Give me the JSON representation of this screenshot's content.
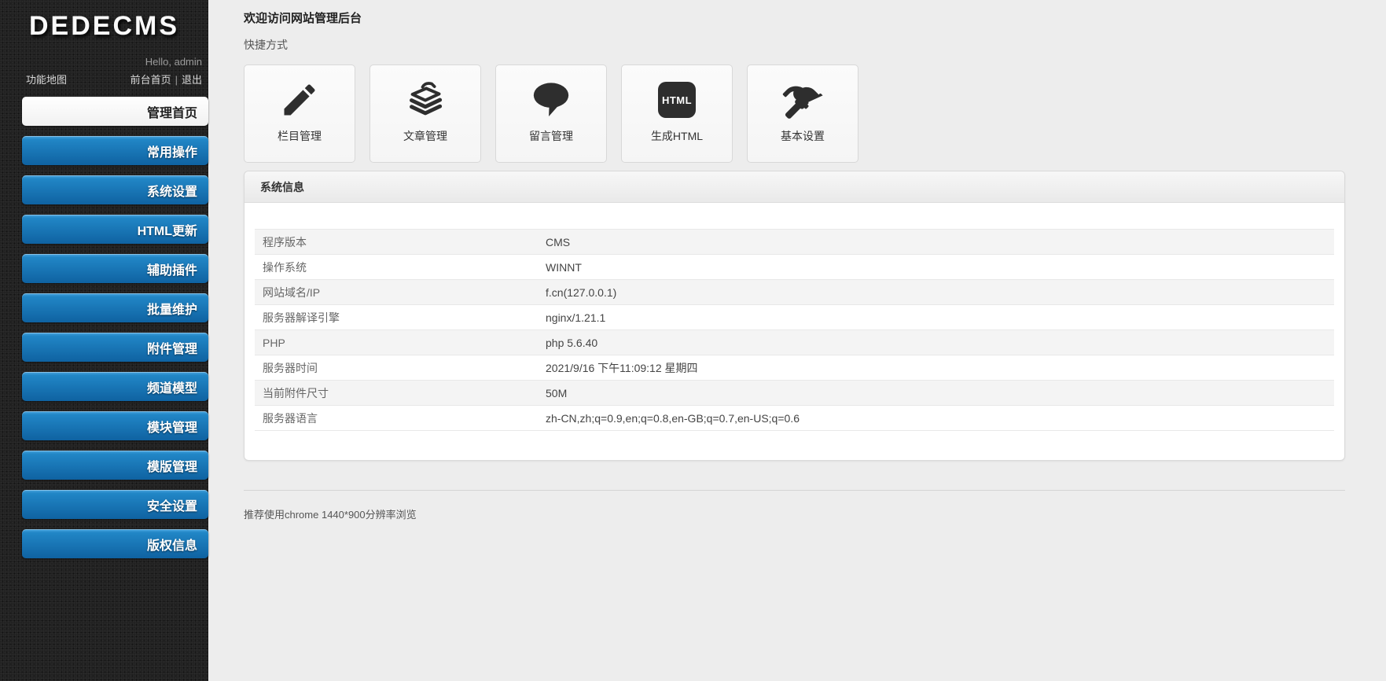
{
  "sidebar": {
    "logo": "DEDECMS",
    "greeting": "Hello, admin",
    "links": {
      "map": "功能地图",
      "front": "前台首页",
      "divider": "|",
      "logout": "退出"
    },
    "menu": [
      {
        "label": "管理首页",
        "active": true
      },
      {
        "label": "常用操作",
        "active": false
      },
      {
        "label": "系统设置",
        "active": false
      },
      {
        "label": "HTML更新",
        "active": false
      },
      {
        "label": "辅助插件",
        "active": false
      },
      {
        "label": "批量维护",
        "active": false
      },
      {
        "label": "附件管理",
        "active": false
      },
      {
        "label": "频道模型",
        "active": false
      },
      {
        "label": "模块管理",
        "active": false
      },
      {
        "label": "模版管理",
        "active": false
      },
      {
        "label": "安全设置",
        "active": false
      },
      {
        "label": "版权信息",
        "active": false
      }
    ]
  },
  "main": {
    "title": "欢迎访问网站管理后台",
    "shortcuts_label": "快捷方式",
    "shortcuts": [
      {
        "label": "栏目管理",
        "icon": "pencil-icon"
      },
      {
        "label": "文章管理",
        "icon": "stacked-papers-icon"
      },
      {
        "label": "留言管理",
        "icon": "speech-bubble-icon"
      },
      {
        "label": "生成HTML",
        "icon": "html-badge-icon",
        "badge_text": "HTML"
      },
      {
        "label": "基本设置",
        "icon": "hammer-icon"
      }
    ],
    "system_info": {
      "header": "系统信息",
      "rows": [
        {
          "label": "程序版本",
          "value": "CMS"
        },
        {
          "label": "操作系统",
          "value": "WINNT"
        },
        {
          "label": "网站域名/IP",
          "value": "f.cn(127.0.0.1)"
        },
        {
          "label": "服务器解译引擎",
          "value": "nginx/1.21.1"
        },
        {
          "label": "PHP",
          "value": "php 5.6.40"
        },
        {
          "label": "服务器时间",
          "value": "2021/9/16 下午11:09:12 星期四"
        },
        {
          "label": "当前附件尺寸",
          "value": "50M"
        },
        {
          "label": "服务器语言",
          "value": "zh-CN,zh;q=0.9,en;q=0.8,en-GB;q=0.7,en-US;q=0.6"
        }
      ]
    },
    "footer": "推荐使用chrome 1440*900分辨率浏览"
  },
  "colors": {
    "accent_blue_top": "#47a3de",
    "accent_blue_bottom": "#0f62a1",
    "sidebar_bg": "#212121",
    "page_bg": "#ededed",
    "panel_bg": "#ffffff",
    "icon_dark": "#2e2e2e"
  }
}
